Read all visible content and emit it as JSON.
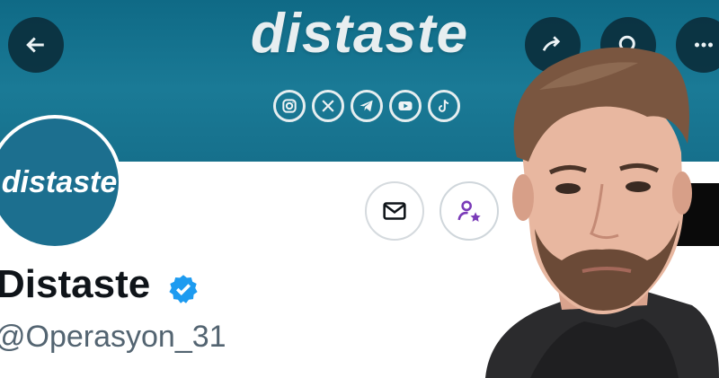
{
  "banner": {
    "title": "distaste",
    "socials": [
      "instagram-icon",
      "x-icon",
      "telegram-icon",
      "youtube-icon",
      "tiktok-icon"
    ]
  },
  "nav": {
    "back_icon": "arrow-left-icon",
    "share_icon": "share-icon",
    "search_icon": "search-icon",
    "more_icon": "more-icon"
  },
  "profile": {
    "avatar_text": "distaste",
    "display_name": "Distaste",
    "handle": "@Operasyon_31",
    "verified": true
  },
  "actions": {
    "message_icon": "mail-icon",
    "follow_icon": "person-star-icon"
  },
  "colors": {
    "banner": "#1a7a96",
    "avatar": "#1c6f8f",
    "verified": "#1d9bf0",
    "accent_purple": "#7a3bb8"
  }
}
